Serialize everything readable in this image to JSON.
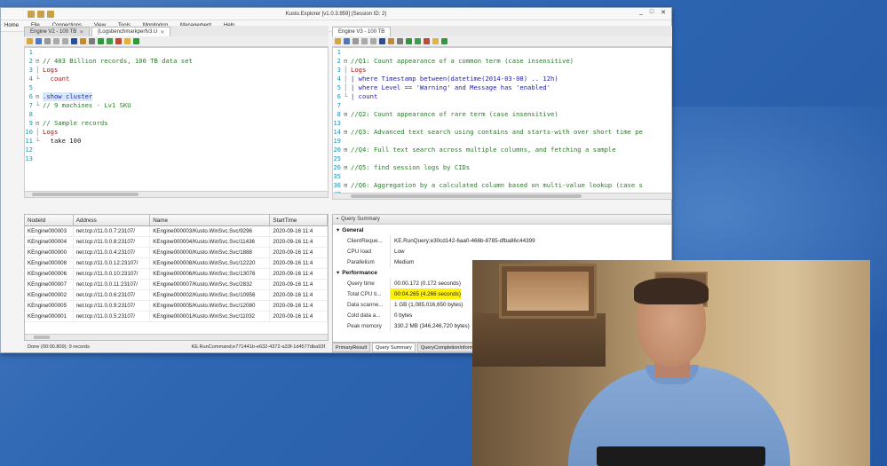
{
  "window": {
    "title": "Kusto.Explorer [v1.0.3.959] (Session ID: 2)",
    "controls": [
      "_",
      "□",
      "✕"
    ]
  },
  "menu": [
    "Home",
    "File",
    "Connections",
    "View",
    "Tools",
    "Monitoring",
    "Management",
    "Help"
  ],
  "left_pane": {
    "tabs": [
      {
        "label": "Engine V2 - 100 TB",
        "active": false
      },
      {
        "label": "[Logsbenchmarkperfv3.U",
        "active": true
      }
    ],
    "code": [
      {
        "n": "1",
        "text": ""
      },
      {
        "n": "2",
        "text": "// 403 Billion records, 100 TB data set",
        "cls": "cm",
        "fold": "⊟"
      },
      {
        "n": "3",
        "text": "Logs",
        "cls": "str",
        "fold": "│"
      },
      {
        "n": "4",
        "text": "  count",
        "cls": "str",
        "fold": "└"
      },
      {
        "n": "5",
        "text": ""
      },
      {
        "n": "6",
        "text": ".show cluster",
        "cls": "kw hl",
        "fold": "⊟"
      },
      {
        "n": "7",
        "text": "// 9 machines - Lv1 SKU",
        "cls": "cm",
        "fold": "└"
      },
      {
        "n": "8",
        "text": ""
      },
      {
        "n": "9",
        "text": "// Sample records",
        "cls": "cm",
        "fold": "⊟"
      },
      {
        "n": "10",
        "text": "Logs",
        "cls": "str",
        "fold": "│"
      },
      {
        "n": "11",
        "text": "  take 100",
        "cls": "plain",
        "fold": "└"
      },
      {
        "n": "12",
        "text": ""
      },
      {
        "n": "13",
        "text": ""
      }
    ]
  },
  "right_pane": {
    "tabs": [
      {
        "label": "Engine V3 - 100 TB",
        "active": true
      }
    ],
    "code": [
      {
        "n": "1",
        "text": ""
      },
      {
        "n": "2",
        "text": "//Q1: Count appearance of a common term (case insensitive)",
        "cls": "cm",
        "fold": "⊟"
      },
      {
        "n": "3",
        "text": "Logs",
        "cls": "str",
        "fold": "│"
      },
      {
        "n": "4",
        "text": "| where Timestamp between(datetime(2014-03-08) .. 12h)",
        "cls": "kw",
        "fold": "│"
      },
      {
        "n": "5",
        "text": "| where Level == 'Warning' and Message has 'enabled'",
        "cls": "kw",
        "fold": "│"
      },
      {
        "n": "6",
        "text": "| count",
        "cls": "kw",
        "fold": "└"
      },
      {
        "n": "7",
        "text": ""
      },
      {
        "n": "8",
        "text": "//Q2: Count appearance of rare term (case insensitive)",
        "cls": "cm",
        "fold": "⊞"
      },
      {
        "n": "13",
        "text": ""
      },
      {
        "n": "14",
        "text": "//Q3: Advanced text search using contains and starts-with over short time pe",
        "cls": "cm",
        "fold": "⊞"
      },
      {
        "n": "19",
        "text": ""
      },
      {
        "n": "20",
        "text": "//Q4: Full text search across multiple columns, and fetching a sample",
        "cls": "cm",
        "fold": "⊞"
      },
      {
        "n": "25",
        "text": ""
      },
      {
        "n": "26",
        "text": "//Q5: find session logs by CIDs",
        "cls": "cm",
        "fold": "⊞"
      },
      {
        "n": "35",
        "text": ""
      },
      {
        "n": "36",
        "text": "//Q6: Aggregation by a calculated column based on multi-value lookup (case s",
        "cls": "cm",
        "fold": "⊞"
      },
      {
        "n": "47",
        "text": ""
      }
    ]
  },
  "results": {
    "columns": [
      "NodeId",
      "Address",
      "Name",
      "StartTime"
    ],
    "rows": [
      [
        "KEngine000003",
        "net.tcp://11.0.0.7:23107/",
        "KEngine000003/Kusto.WinSvc.Svc/9296",
        "2020-09-16 11:4"
      ],
      [
        "KEngine000004",
        "net.tcp://11.0.0.8:23107/",
        "KEngine000004/Kusto.WinSvc.Svc/11436",
        "2020-09-16 11:4"
      ],
      [
        "KEngine000000",
        "net.tcp://11.0.0.4:23107/",
        "KEngine000000/Kusto.WinSvc.Svc/1888",
        "2020-09-16 11:4"
      ],
      [
        "KEngine000008",
        "net.tcp://11.0.0.12:23107/",
        "KEngine000008/Kusto.WinSvc.Svc/12220",
        "2020-09-16 11:4"
      ],
      [
        "KEngine000006",
        "net.tcp://11.0.0.10:23107/",
        "KEngine000006/Kusto.WinSvc.Svc/13076",
        "2020-09-16 11:4"
      ],
      [
        "KEngine000007",
        "net.tcp://11.0.0.11:23107/",
        "KEngine000007/Kusto.WinSvc.Svc/2832",
        "2020-09-16 11:4"
      ],
      [
        "KEngine000002",
        "net.tcp://11.0.0.6:23107/",
        "KEngine000002/Kusto.WinSvc.Svc/10956",
        "2020-09-16 11:4"
      ],
      [
        "KEngine000005",
        "net.tcp://11.0.0.9:23107/",
        "KEngine000005/Kusto.WinSvc.Svc/12080",
        "2020-09-16 11:4"
      ],
      [
        "KEngine000001",
        "net.tcp://11.0.0.5:23107/",
        "KEngine000001/Kusto.WinSvc.Svc/11032",
        "2020-09-16 11:4"
      ]
    ],
    "status_left": "Done (00:00.809): 9 records",
    "status_right": "KE.RunCommand;e771441b-e632-4372-a33f-1d4577dba93f"
  },
  "query_summary": {
    "title": "Query Summary",
    "sections": [
      {
        "name": "General",
        "rows": [
          {
            "k": "ClientReque...",
            "v": "KE.RunQuery;e30cd142-6aa0-466b-8785-dfba86c44399"
          },
          {
            "k": "CPU load",
            "v": "Low"
          },
          {
            "k": "Parallelism",
            "v": "Medium"
          }
        ]
      },
      {
        "name": "Performance",
        "rows": [
          {
            "k": "Query time",
            "v": "00:00.172 (0.172 seconds)"
          },
          {
            "k": "Total CPU ti...",
            "v": "00:04.265 (4.266 seconds)",
            "highlight": true
          },
          {
            "k": "Data scanne...",
            "v": "1 GB (1,085,016,650 bytes)"
          },
          {
            "k": "Cold data a...",
            "v": "0 bytes"
          },
          {
            "k": "Peak memory",
            "v": "330.2 MB (346,246,720 bytes)"
          }
        ]
      }
    ],
    "bottom_tabs": [
      {
        "label": "PrimaryResult",
        "active": false
      },
      {
        "label": "Query Summary",
        "active": true
      },
      {
        "label": "QueryCompletionInform",
        "active": false
      }
    ]
  }
}
